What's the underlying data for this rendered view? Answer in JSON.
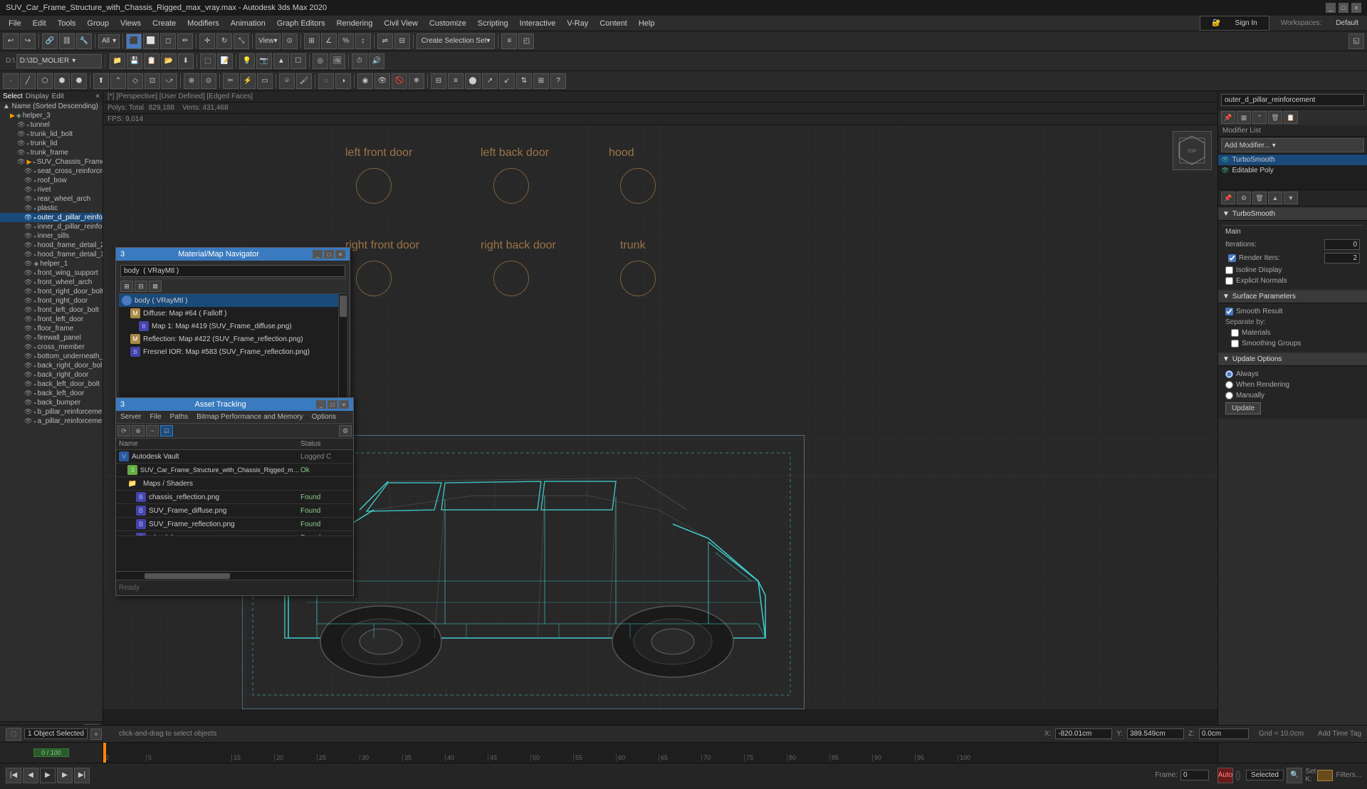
{
  "window": {
    "title": "SUV_Car_Frame_Structure_with_Chassis_Rigged_max_vray.max - Autodesk 3ds Max 2020",
    "controls": [
      "_",
      "□",
      "×"
    ]
  },
  "menu_bar": {
    "items": [
      "File",
      "Edit",
      "Tools",
      "Group",
      "Views",
      "Create",
      "Modifiers",
      "Animation",
      "Graph Editors",
      "Rendering",
      "Civil View",
      "Customize",
      "Scripting",
      "Interactive",
      "V-Ray",
      "Content",
      "Help"
    ]
  },
  "toolbar1": {
    "mode_buttons": [
      "Select",
      "Move",
      "Rotate",
      "Scale"
    ],
    "filter_label": "All",
    "view_label": "View",
    "create_selection": "Create Selection Set",
    "sign_in": "Sign In",
    "workspace_label": "Workspaces:",
    "workspace_value": "Default"
  },
  "viewport": {
    "header": "[*] [Perspective] [User Defined] [Edged Faces]",
    "stats": {
      "polys_label": "Polys:",
      "polys_total_label": "Total",
      "polys_value": "829,188",
      "verts_label": "Verts:",
      "verts_value": "431,468"
    },
    "fps_label": "FPS:",
    "fps_value": "9,014",
    "labels": {
      "left_front_door": "left front door",
      "left_back_door": "left back door",
      "hood": "hood",
      "right_front_door": "right front door",
      "right_back_door": "right back door",
      "trunk": "trunk"
    }
  },
  "scene_tree": {
    "header_tabs": [
      "Select",
      "Display",
      "Edit"
    ],
    "items": [
      {
        "name": "Name (Sorted Descending)",
        "indent": 0,
        "icon": "sort"
      },
      {
        "name": "helper_3",
        "indent": 1,
        "icon": "helper",
        "expanded": true
      },
      {
        "name": "tunnel",
        "indent": 2,
        "icon": "geo"
      },
      {
        "name": "trunk_lid_bolt",
        "indent": 2,
        "icon": "geo"
      },
      {
        "name": "trunk_lid",
        "indent": 2,
        "icon": "geo"
      },
      {
        "name": "trunk_frame",
        "indent": 2,
        "icon": "geo"
      },
      {
        "name": "SUV_Chassis_Frame",
        "indent": 2,
        "icon": "geo",
        "expanded": true
      },
      {
        "name": "seat_cross_reinforcements",
        "indent": 3,
        "icon": "geo"
      },
      {
        "name": "roof_bow",
        "indent": 3,
        "icon": "geo"
      },
      {
        "name": "rivet",
        "indent": 3,
        "icon": "geo"
      },
      {
        "name": "rear_wheel_arch",
        "indent": 3,
        "icon": "geo"
      },
      {
        "name": "plastic",
        "indent": 3,
        "icon": "geo"
      },
      {
        "name": "outer_d_pillar_reinforcment",
        "indent": 3,
        "icon": "geo",
        "selected": true
      },
      {
        "name": "inner_d_pillar_reinforcment",
        "indent": 3,
        "icon": "geo"
      },
      {
        "name": "inner_sills",
        "indent": 3,
        "icon": "geo"
      },
      {
        "name": "hood_frame_detail_2",
        "indent": 3,
        "icon": "geo"
      },
      {
        "name": "hood_frame_detail_1",
        "indent": 3,
        "icon": "geo"
      },
      {
        "name": "helper_1",
        "indent": 3,
        "icon": "helper"
      },
      {
        "name": "front_wing_support",
        "indent": 3,
        "icon": "geo"
      },
      {
        "name": "front_wheel_arch",
        "indent": 3,
        "icon": "geo"
      },
      {
        "name": "front_right_door_bolt",
        "indent": 3,
        "icon": "geo"
      },
      {
        "name": "front_right_door",
        "indent": 3,
        "icon": "geo"
      },
      {
        "name": "front_left_door_bolt",
        "indent": 3,
        "icon": "geo"
      },
      {
        "name": "front_left_door",
        "indent": 3,
        "icon": "geo"
      },
      {
        "name": "floor_frame",
        "indent": 3,
        "icon": "geo"
      },
      {
        "name": "firewall_panel",
        "indent": 3,
        "icon": "geo"
      },
      {
        "name": "cross_member",
        "indent": 3,
        "icon": "geo"
      },
      {
        "name": "bottom_underneath_rear_",
        "indent": 3,
        "icon": "geo"
      },
      {
        "name": "back_right_door_bolt",
        "indent": 3,
        "icon": "geo"
      },
      {
        "name": "back_right_door",
        "indent": 3,
        "icon": "geo"
      },
      {
        "name": "back_left_door_bolt",
        "indent": 3,
        "icon": "geo"
      },
      {
        "name": "back_left_door",
        "indent": 3,
        "icon": "geo"
      },
      {
        "name": "back_bumper",
        "indent": 3,
        "icon": "geo"
      },
      {
        "name": "b_pillar_reinforcement",
        "indent": 3,
        "icon": "geo"
      },
      {
        "name": "a_pillar_reinforcement",
        "indent": 3,
        "icon": "geo"
      }
    ]
  },
  "right_panel": {
    "object_name": "outer_d_pillar_reinforcement",
    "icons": [
      "pin",
      "mesh",
      "cam",
      "del",
      "copy"
    ],
    "modifier_list_label": "Modifier List",
    "modifiers": [
      {
        "name": "TurboSmooth",
        "selected": true,
        "visible": true
      },
      {
        "name": "Editable Poly",
        "visible": true
      }
    ],
    "turbosmooth": {
      "section_label": "TurboSmooth",
      "main_label": "Main",
      "iterations_label": "Iterations:",
      "iterations_value": "0",
      "render_iters_label": "Render Iters:",
      "render_iters_value": "2",
      "isoline_label": "Isoline Display",
      "explicit_normals_label": "Explicit Normals"
    },
    "surface_params": {
      "section_label": "Surface Parameters",
      "smooth_result_label": "Smooth Result",
      "separate_by_label": "Separate by:",
      "materials_label": "Materials",
      "smoothing_groups_label": "Smoothing Groups"
    },
    "update_options": {
      "section_label": "Update Options",
      "always_label": "Always",
      "when_rendering_label": "When Rendering",
      "manually_label": "Manually",
      "update_btn": "Update"
    }
  },
  "material_navigator": {
    "title": "Material/Map Navigator",
    "search_value": "body  ( VRayMtl )",
    "tree_items": [
      {
        "name": "body  ( VRayMtl )",
        "indent": 0,
        "selected": true,
        "icon": "sphere_blue"
      },
      {
        "name": "Diffuse: Map #64  ( Falloff )",
        "indent": 1,
        "icon": "map"
      },
      {
        "name": "Map 1: Map #419 (SUV_Frame_diffuse.png)",
        "indent": 2,
        "icon": "map"
      },
      {
        "name": "Reflection: Map #422 (SUV_Frame_reflection.png)",
        "indent": 1,
        "icon": "map"
      },
      {
        "name": "Fresnel IOR: Map #583 (SUV_Frame_reflection.png)",
        "indent": 1,
        "icon": "map"
      }
    ]
  },
  "asset_tracking": {
    "title": "Asset Tracking",
    "menu_items": [
      "Server",
      "File",
      "Paths",
      "Bitmap Performance and Memory",
      "Options"
    ],
    "table_headers": [
      "Name",
      "Status"
    ],
    "rows": [
      {
        "name": "Autodesk Vault",
        "status": "Logged C",
        "indent": 0,
        "icon": "vault"
      },
      {
        "name": "SUV_Car_Frame_Structure_with_Chassis_Rigged_max_vray.max",
        "status": "Ok",
        "indent": 1,
        "icon": "file"
      },
      {
        "name": "Maps / Shaders",
        "status": "",
        "indent": 1,
        "icon": "folder"
      },
      {
        "name": "chassis_reflection.png",
        "status": "Found",
        "indent": 2,
        "icon": "img"
      },
      {
        "name": "SUV_Frame_diffuse.png",
        "status": "Found",
        "indent": 2,
        "icon": "img"
      },
      {
        "name": "SUV_Frame_reflection.png",
        "status": "Found",
        "indent": 2,
        "icon": "img"
      },
      {
        "name": "wheel_bump.png",
        "status": "Found",
        "indent": 2,
        "icon": "img"
      }
    ]
  },
  "bottom": {
    "status_text": "1 Object Selected",
    "hint_text": "click-and-drag to select objects",
    "coords": {
      "x_label": "X:",
      "x_value": "-820.01cm",
      "y_label": "Y:",
      "y_value": "389.549cm",
      "z_label": "Z:",
      "z_value": "0.0cm"
    },
    "grid": "Grid = 10.0cm",
    "time_tag": "Add Time Tag",
    "playback": {
      "auto_label": "Auto",
      "selected_label": "Selected",
      "set_k_label": "Set K:"
    },
    "timeline_marks": [
      "0",
      "5",
      "15",
      "20",
      "25",
      "30",
      "35",
      "40",
      "45",
      "50",
      "55",
      "60",
      "65",
      "70",
      "75",
      "80",
      "85",
      "90",
      "95",
      "100"
    ]
  },
  "path_bar": {
    "path": "D:\\3D_MOLIER"
  },
  "colors": {
    "accent_blue": "#3a7abf",
    "selection_blue": "#1a4a7a",
    "car_wire": "#4dd",
    "label_orange": "#b8864e",
    "found_green": "#88cc88"
  }
}
